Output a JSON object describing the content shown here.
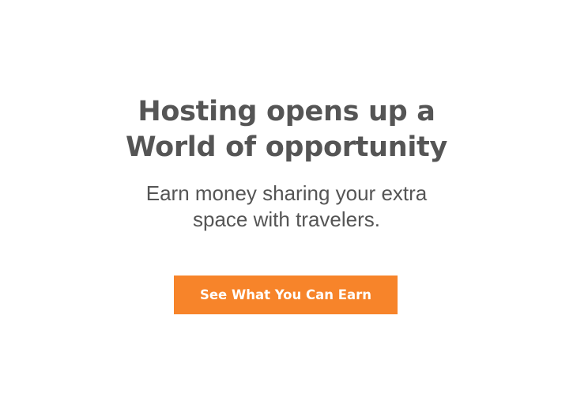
{
  "hero": {
    "headline_line1": "Hosting opens up a",
    "headline_line2": "World of opportunity",
    "subtext_line1": "Earn money sharing your extra",
    "subtext_line2": "space with travelers.",
    "cta_label": "See What You Can Earn"
  },
  "colors": {
    "background": "#ffffff",
    "text": "#555555",
    "cta_background": "#f7842a",
    "cta_text": "#ffffff"
  }
}
